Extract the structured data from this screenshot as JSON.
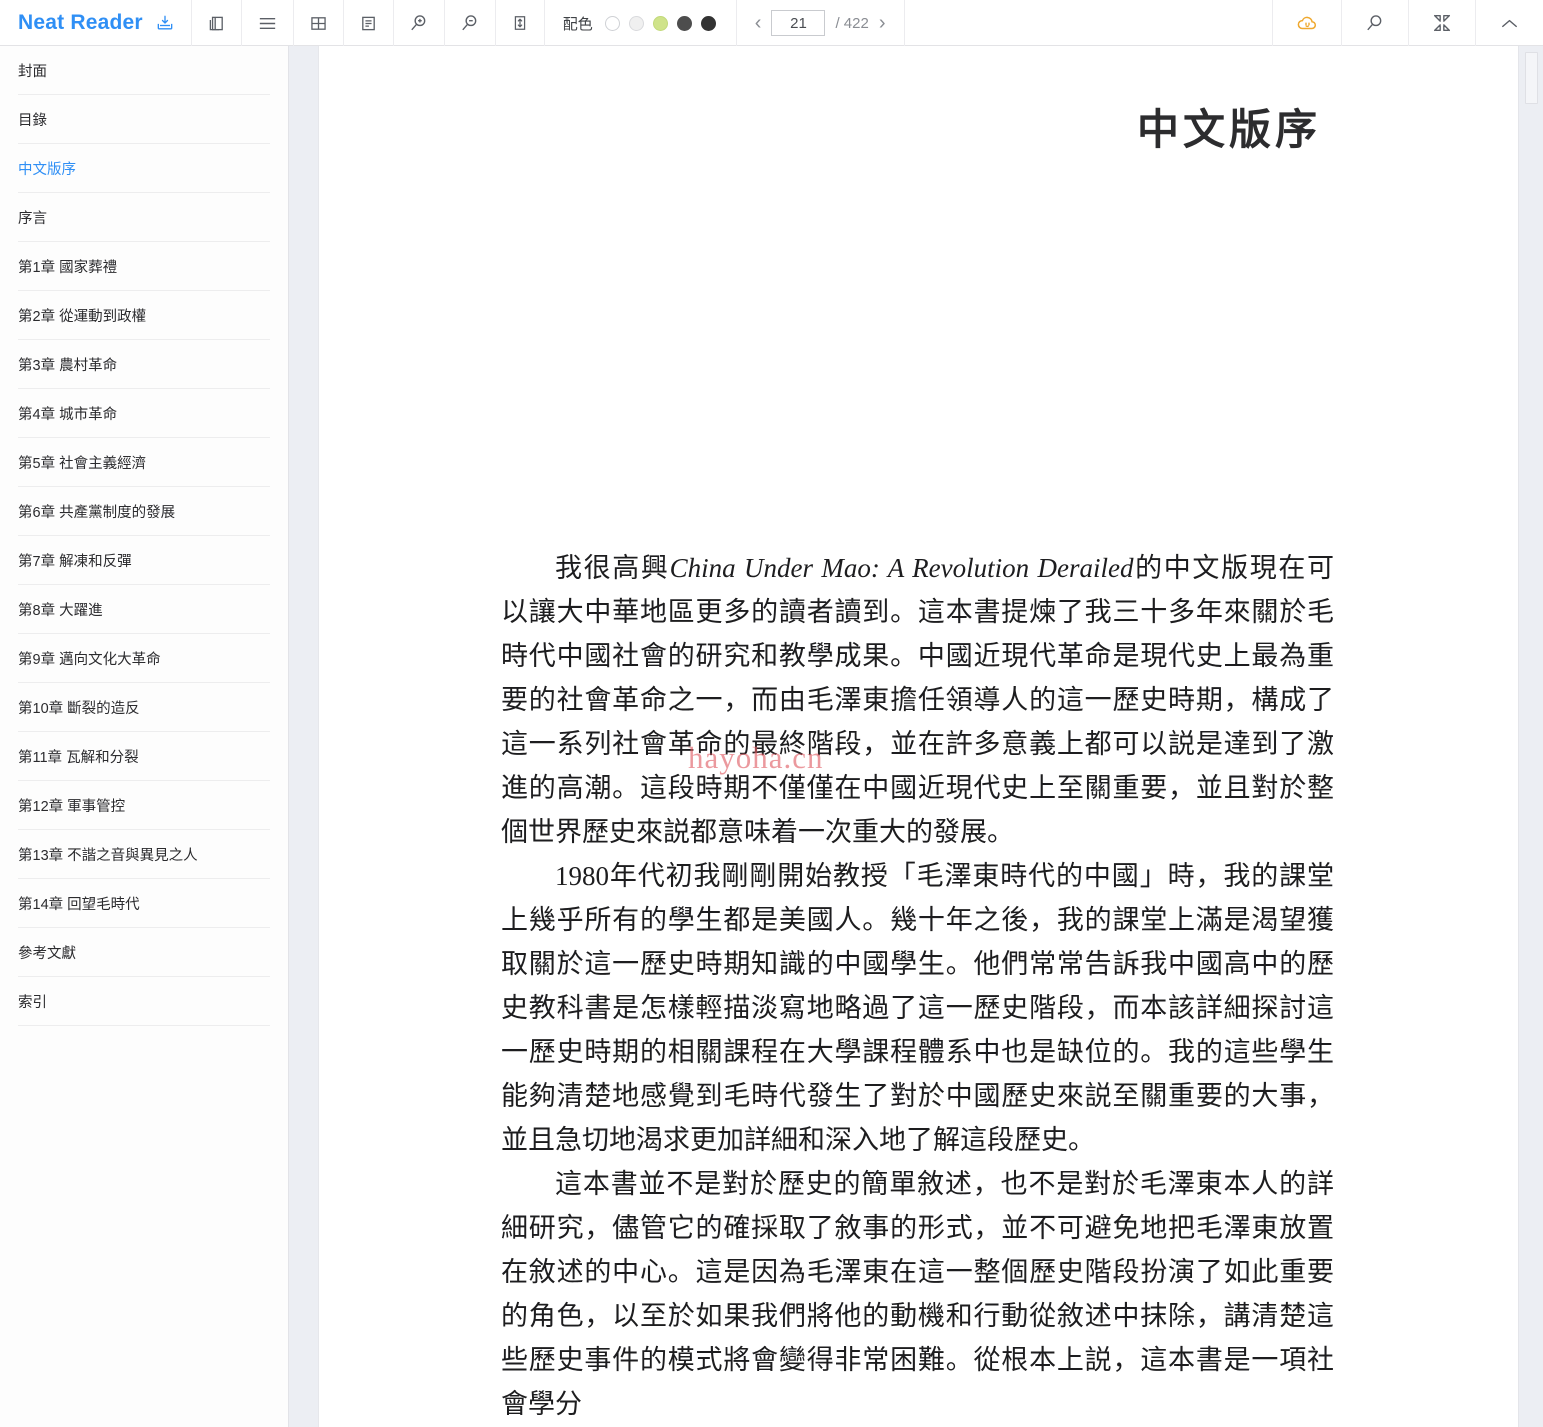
{
  "app": {
    "brand": "Neat Reader",
    "brand_color": "#2f8ff5"
  },
  "toolbar": {
    "icons": [
      {
        "name": "download-icon",
        "label": "下載"
      },
      {
        "name": "copy-pages-icon",
        "label": "分頁模式"
      },
      {
        "name": "menu-icon",
        "label": "目錄"
      },
      {
        "name": "grid-layout-icon",
        "label": "網格版面"
      },
      {
        "name": "text-layout-icon",
        "label": "文字版面"
      },
      {
        "name": "zoom-in-icon",
        "label": "放大"
      },
      {
        "name": "zoom-out-icon",
        "label": "縮小"
      },
      {
        "name": "line-height-icon",
        "label": "行距"
      }
    ],
    "color_scheme": {
      "label": "配色",
      "selected_index": 0,
      "swatches": [
        {
          "name": "swatch-white",
          "color": "#ffffff",
          "border": "#cfd1d5",
          "selected": true
        },
        {
          "name": "swatch-light-gray",
          "color": "#f0f0f0",
          "border": "#d9dadd",
          "selected": false
        },
        {
          "name": "swatch-green",
          "color": "#cfe38a",
          "border": "#c2d97a",
          "selected": false
        },
        {
          "name": "swatch-dark-gray",
          "color": "#4d4d4d",
          "border": "#4d4d4d",
          "selected": false
        },
        {
          "name": "swatch-black",
          "color": "#333333",
          "border": "#333333",
          "selected": false
        }
      ]
    },
    "pager": {
      "prev_label": "‹",
      "next_label": "›",
      "current_page": "21",
      "total_label": "/ 422",
      "total_pages": 422
    },
    "right_icons": [
      {
        "name": "cloud-sync-icon",
        "label": "雲端同步",
        "color": "#efa82e"
      },
      {
        "name": "search-icon",
        "label": "搜尋",
        "color": "#5b5f66"
      },
      {
        "name": "contract-icon",
        "label": "收起",
        "color": "#5b5f66"
      },
      {
        "name": "chevron-up-icon",
        "label": "隱藏工具列",
        "color": "#5b5f66"
      }
    ]
  },
  "sidebar": {
    "active_index": 2,
    "items": [
      {
        "label": "封面"
      },
      {
        "label": "目錄"
      },
      {
        "label": "中文版序"
      },
      {
        "label": "序言"
      },
      {
        "label": "第1章 國家葬禮"
      },
      {
        "label": "第2章 從運動到政權"
      },
      {
        "label": "第3章 農村革命"
      },
      {
        "label": "第4章 城市革命"
      },
      {
        "label": "第5章 社會主義經濟"
      },
      {
        "label": "第6章 共產黨制度的發展"
      },
      {
        "label": "第7章 解凍和反彈"
      },
      {
        "label": "第8章 大躍進"
      },
      {
        "label": "第9章 邁向文化大革命"
      },
      {
        "label": "第10章 斷裂的造反"
      },
      {
        "label": "第11章 瓦解和分裂"
      },
      {
        "label": "第12章 軍事管控"
      },
      {
        "label": "第13章 不諧之音與異見之人"
      },
      {
        "label": "第14章 回望毛時代"
      },
      {
        "label": "參考文獻"
      },
      {
        "label": "索引"
      }
    ]
  },
  "content": {
    "title": "中文版序",
    "watermark": "hayoha.cn",
    "paragraphs": [
      {
        "segments": [
          {
            "text": "我很高興",
            "style": "normal"
          },
          {
            "text": "China Under Mao: A Revolution Derailed",
            "style": "italic"
          },
          {
            "text": "的中文版現在可以讓大中華地區更多的讀者讀到。這本書提煉了我三十多年來關於毛時代中國社會的研究和教學成果。中國近現代革命是現代史上最為重要的社會革命之一，而由毛澤東擔任領導人的這一歷史時期，構成了這一系列社會革命的最終階段，並在許多意義上都可以説是達到了激進的高潮。這段時期不僅僅在中國近現代史上至關重要，並且對於整個世界歷史來説都意味着一次重大的發展。",
            "style": "normal"
          }
        ]
      },
      {
        "segments": [
          {
            "text": "1980年代初我剛剛開始教授「毛澤東時代的中國」時，我的課堂上幾乎所有的學生都是美國人。幾十年之後，我的課堂上滿是渴望獲取關於這一歷史時期知識的中國學生。他們常常告訴我中國高中的歷史教科書是怎樣輕描淡寫地略過了這一歷史階段，而本該詳細探討這一歷史時期的相關課程在大學課程體系中也是缺位的。我的這些學生能夠清楚地感覺到毛時代發生了對於中國歷史來説至關重要的大事，並且急切地渴求更加詳細和深入地了解這段歷史。",
            "style": "normal"
          }
        ]
      },
      {
        "segments": [
          {
            "text": "這本書並不是對於歷史的簡單敘述，也不是對於毛澤東本人的詳細研究，儘管它的確採取了敘事的形式，並不可避免地把毛澤東放置在敘述的中心。這是因為毛澤東在這一整個歷史階段扮演了如此重要的角色，以至於如果我們將他的動機和行動從敘述中抹除，講清楚這些歷史事件的模式將會變得非常困難。從根本上説，這本書是一項社會學分",
            "style": "normal"
          }
        ]
      }
    ]
  }
}
